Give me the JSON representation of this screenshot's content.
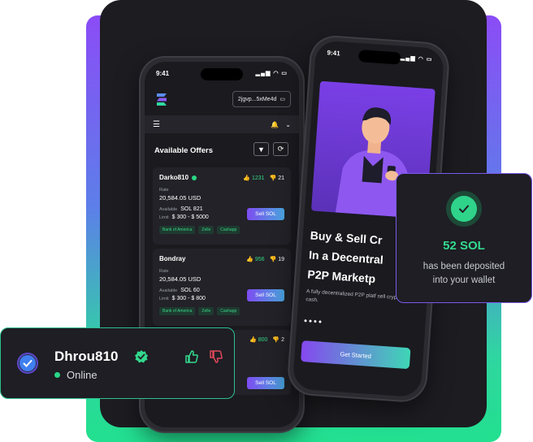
{
  "left_phone": {
    "time": "9:41",
    "wallet_address": "2jgvp...5xMe4d",
    "section_title": "Available Offers",
    "offers": [
      {
        "user": "Darko810",
        "likes": "1231",
        "dislikes": "21",
        "rate_label": "Rate",
        "rate": "20,584.05 USD",
        "available_label": "Available",
        "available": "SOL 821",
        "limit_label": "Limit",
        "limit": "$ 300 - $ 5000",
        "button": "Sell SOL",
        "methods": [
          "Bank of America",
          "Zelle",
          "Cashapp"
        ]
      },
      {
        "user": "Bondray",
        "likes": "956",
        "dislikes": "19",
        "rate_label": "Rate",
        "rate": "20,584.05 USD",
        "available_label": "Available",
        "available": "SOL 60",
        "limit_label": "Limit",
        "limit": "$ 300 - $ 800",
        "button": "Sell SOL",
        "methods": [
          "Bank of America",
          "Zelle",
          "Cashapp"
        ]
      },
      {
        "likes": "800",
        "dislikes": "2",
        "button": "Sell SOL"
      }
    ]
  },
  "right_phone": {
    "time": "9:41",
    "headline_line1": "Buy & Sell Cr",
    "headline_line2": "In a Decentral",
    "headline_line3": "P2P Marketp",
    "description": "A fully decentralized P2P platf sell crypto using cash.",
    "cta": "Get Started"
  },
  "deposit_popup": {
    "amount": "52 SOL",
    "message_line1": "has been deposited",
    "message_line2": "into your wallet"
  },
  "user_popup": {
    "username": "Dhrou810",
    "status": "Online"
  },
  "colors": {
    "accent_green": "#33d98e",
    "accent_purple": "#7b58e8",
    "dislike_red": "#e0495a"
  }
}
